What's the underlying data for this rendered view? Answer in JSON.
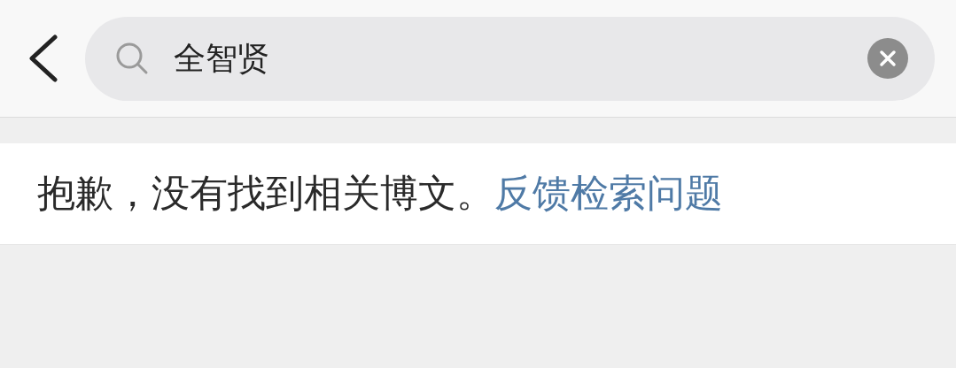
{
  "search": {
    "value": "全智贤"
  },
  "result": {
    "message": "抱歉，没有找到相关博文。",
    "link": "反馈检索问题"
  }
}
